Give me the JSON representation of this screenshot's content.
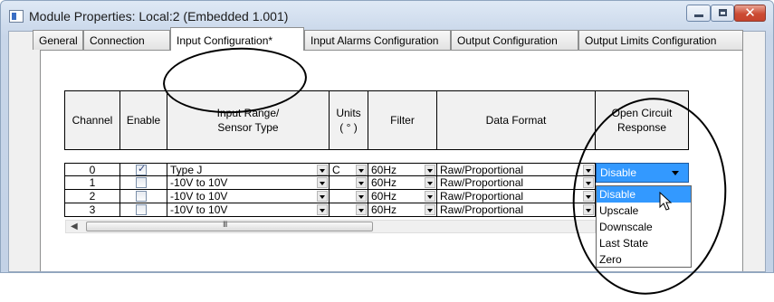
{
  "window": {
    "title": "Module Properties: Local:2 (Embedded 1.001)",
    "close_glyph": "✕"
  },
  "tabs": [
    {
      "label": "General"
    },
    {
      "label": "Connection"
    },
    {
      "label": "Input Configuration*"
    },
    {
      "label": "Input Alarms Configuration"
    },
    {
      "label": "Output Configuration"
    },
    {
      "label": "Output Limits Configuration"
    }
  ],
  "active_tab": "Input Configuration*",
  "table": {
    "headers": {
      "channel": "Channel",
      "enable": "Enable",
      "input_range": "Input Range/\nSensor Type",
      "units": "Units\n( ° )",
      "filter": "Filter",
      "data_format": "Data Format",
      "open_circuit": "Open Circuit\nResponse"
    },
    "rows": [
      {
        "channel": "0",
        "enabled": true,
        "input_range": "Type J",
        "units": "C",
        "filter": "60Hz",
        "data_format": "Raw/Proportional",
        "open_circuit": "Disable"
      },
      {
        "channel": "1",
        "enabled": false,
        "input_range": "-10V to 10V",
        "units": "",
        "filter": "60Hz",
        "data_format": "Raw/Proportional",
        "open_circuit": ""
      },
      {
        "channel": "2",
        "enabled": false,
        "input_range": "-10V to 10V",
        "units": "",
        "filter": "60Hz",
        "data_format": "Raw/Proportional",
        "open_circuit": ""
      },
      {
        "channel": "3",
        "enabled": false,
        "input_range": "-10V to 10V",
        "units": "",
        "filter": "60Hz",
        "data_format": "Raw/Proportional",
        "open_circuit": ""
      }
    ]
  },
  "open_circuit_dropdown": {
    "selected": "Disable",
    "options": [
      "Disable",
      "Upscale",
      "Downscale",
      "Last State",
      "Zero"
    ],
    "highlighted": "Disable"
  },
  "scrollbar": {
    "grip": "III"
  },
  "colors": {
    "selection": "#3399ff",
    "close_button": "#cc4b33"
  }
}
